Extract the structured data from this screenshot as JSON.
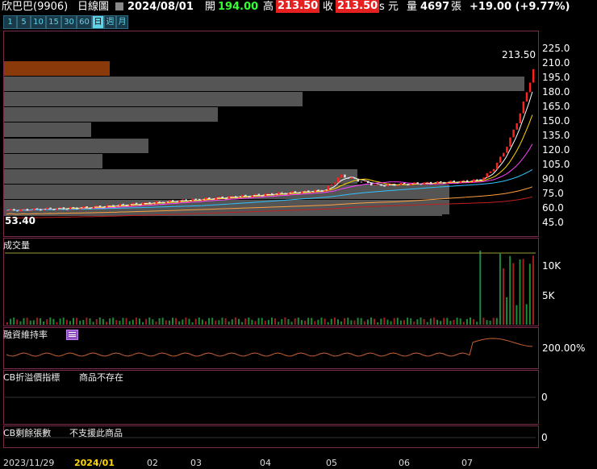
{
  "header": {
    "stock": "欣巴巴(9906)",
    "period": "日線圖",
    "date": "2024/08/01",
    "open_label": "開",
    "open": "194.00",
    "high_label": "高",
    "high": "213.50",
    "close_label": "收",
    "close": "213.50",
    "unit": "s 元",
    "vol_label": "量",
    "volume": "4697",
    "vol_unit": "張",
    "change": "+19.00 (+9.77%)"
  },
  "timeframes": [
    "1",
    "5",
    "10",
    "15",
    "30",
    "60",
    "日",
    "週",
    "月"
  ],
  "price_panel": {
    "max_label": "213.50",
    "min_label": "53.40",
    "yticks": [
      "225.0",
      "210.0",
      "195.0",
      "180.0",
      "165.0",
      "150.0",
      "135.0",
      "120.0",
      "105.0",
      "90.0",
      "75.0",
      "60.0",
      "45.0"
    ]
  },
  "volume_panel": {
    "title": "成交量",
    "yticks": [
      "10K",
      "5K"
    ]
  },
  "margin_panel": {
    "title": "融資維持率",
    "ytick": "200.00%"
  },
  "cb_panel": {
    "title": "CB折溢價指標",
    "message": "商品不存在",
    "ytick": "0"
  },
  "cb_remain_panel": {
    "title": "CB剩餘張數",
    "message": "不支援此商品",
    "ytick": "0"
  },
  "xaxis": {
    "labels": [
      "2023/11/29",
      "2024/01",
      "02",
      "03",
      "04",
      "05",
      "06",
      "07"
    ]
  },
  "colors": {
    "up": "#ff2020",
    "down": "#20c020",
    "accent": "#ffd700"
  }
}
